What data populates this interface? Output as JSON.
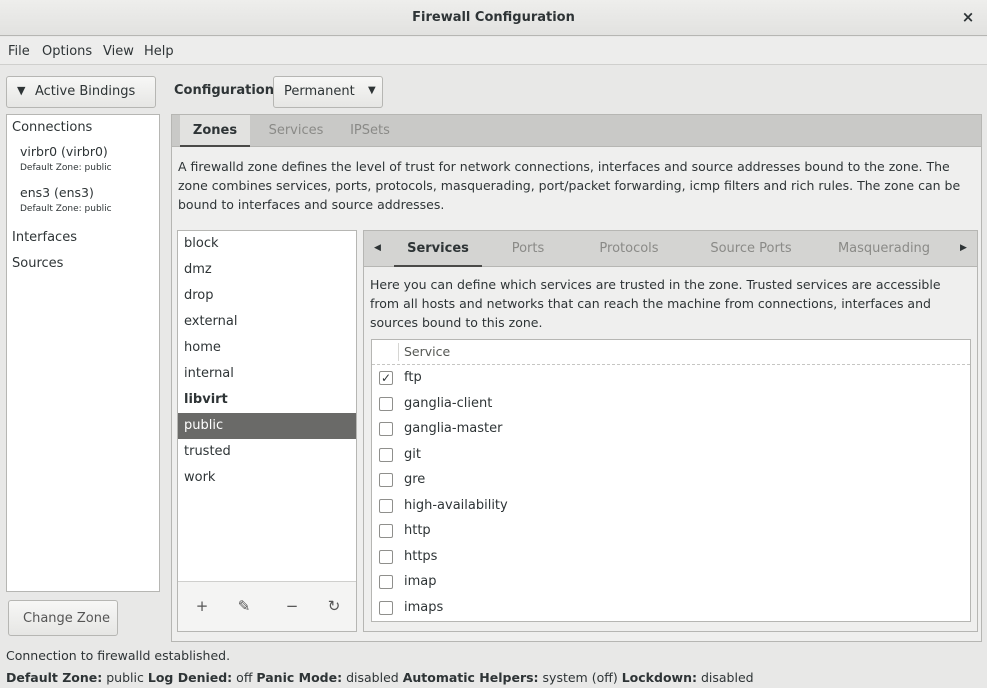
{
  "window": {
    "title": "Firewall Configuration",
    "close_glyph": "×"
  },
  "menu": [
    "File",
    "Options",
    "View",
    "Help"
  ],
  "active_bindings": {
    "label": "Active Bindings",
    "chevron": "✔"
  },
  "configuration": {
    "label": "Configuration:",
    "value": "Permanent"
  },
  "bindings": {
    "connections_label": "Connections",
    "connections": [
      {
        "name": "virbr0 (virbr0)",
        "zone": "Default Zone: public"
      },
      {
        "name": "ens3 (ens3)",
        "zone": "Default Zone: public"
      }
    ],
    "interfaces_label": "Interfaces",
    "sources_label": "Sources"
  },
  "change_zone_label": "Change Zone",
  "top_tabs": [
    {
      "label": "Zones",
      "active": true
    },
    {
      "label": "Services",
      "active": false
    },
    {
      "label": "IPSets",
      "active": false
    }
  ],
  "zones_description": "A firewalld zone defines the level of trust for network connections, interfaces and source addresses bound to the zone. The zone combines services, ports, protocols, masquerading, port/packet forwarding, icmp filters and rich rules. The zone can be bound to interfaces and source addresses.",
  "zones": [
    {
      "name": "block"
    },
    {
      "name": "dmz"
    },
    {
      "name": "drop"
    },
    {
      "name": "external"
    },
    {
      "name": "home"
    },
    {
      "name": "internal"
    },
    {
      "name": "libvirt",
      "bold": true
    },
    {
      "name": "public",
      "selected": true
    },
    {
      "name": "trusted"
    },
    {
      "name": "work"
    }
  ],
  "zone_tools": {
    "add": "+",
    "edit": "✎",
    "remove": "−",
    "reload": "↻"
  },
  "sub_tabs": [
    {
      "label": "Services",
      "active": true
    },
    {
      "label": "Ports",
      "active": false
    },
    {
      "label": "Protocols",
      "active": false
    },
    {
      "label": "Source Ports",
      "active": false
    },
    {
      "label": "Masquerading",
      "active": false
    }
  ],
  "sub_tab_arrows": {
    "left": "◀",
    "right": "▶"
  },
  "services_description": "Here you can define which services are trusted in the zone. Trusted services are accessible from all hosts and networks that can reach the machine from connections, interfaces and sources bound to this zone.",
  "services_header": "Service",
  "services": [
    {
      "name": "ftp",
      "checked": true
    },
    {
      "name": "ganglia-client",
      "checked": false
    },
    {
      "name": "ganglia-master",
      "checked": false
    },
    {
      "name": "git",
      "checked": false
    },
    {
      "name": "gre",
      "checked": false
    },
    {
      "name": "high-availability",
      "checked": false
    },
    {
      "name": "http",
      "checked": false
    },
    {
      "name": "https",
      "checked": false
    },
    {
      "name": "imap",
      "checked": false
    },
    {
      "name": "imaps",
      "checked": false
    }
  ],
  "status": {
    "connection": "Connection to firewalld established.",
    "default_zone_label": "Default Zone:",
    "default_zone": "public",
    "log_denied_label": "Log Denied:",
    "log_denied": "off",
    "panic_label": "Panic Mode:",
    "panic": "disabled",
    "helpers_label": "Automatic Helpers:",
    "helpers": "system (off)",
    "lockdown_label": "Lockdown:",
    "lockdown": "disabled"
  }
}
